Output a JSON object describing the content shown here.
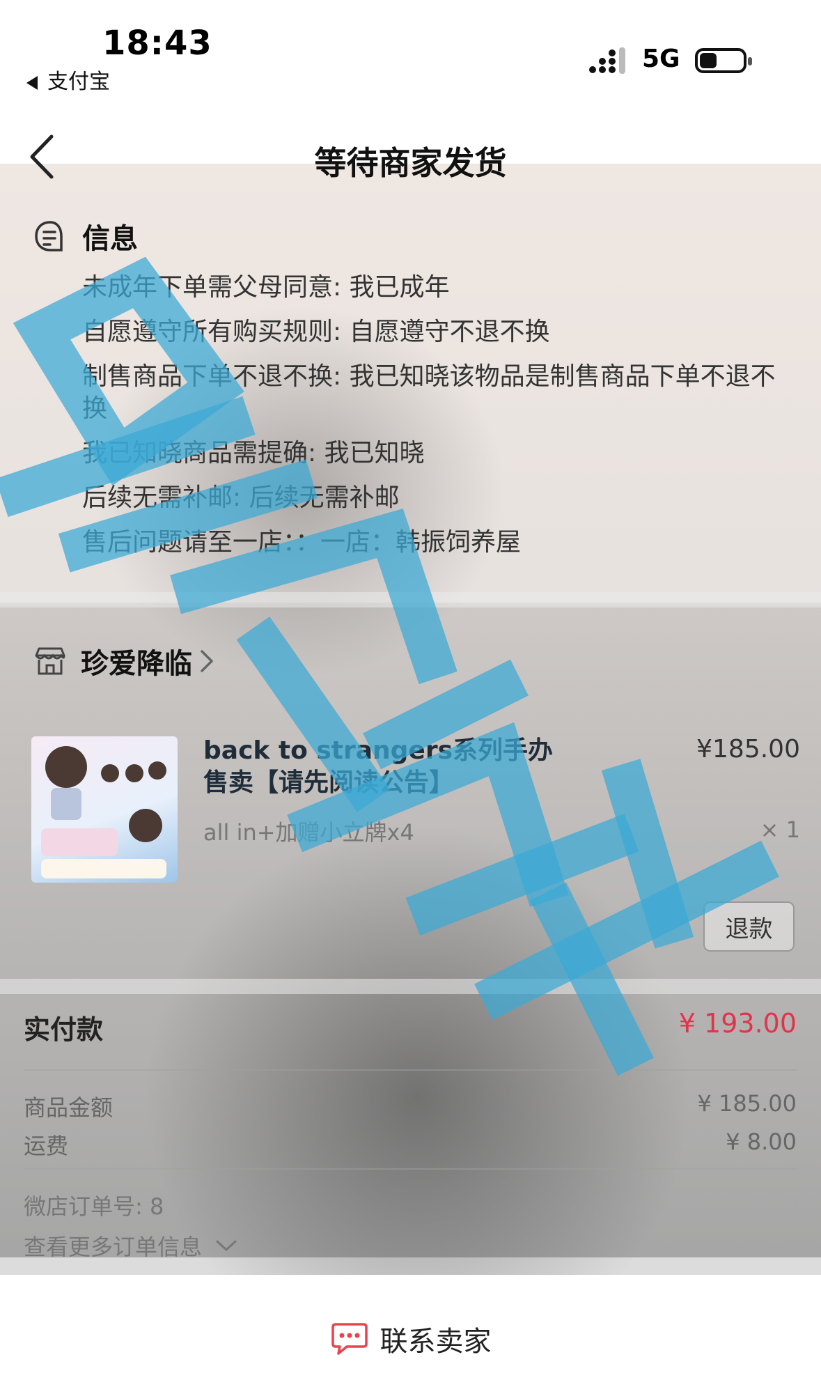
{
  "status_bar": {
    "time": "18:43",
    "back_app": "支付宝",
    "network": "5G"
  },
  "header": {
    "title": "等待商家发货"
  },
  "info": {
    "heading": "信息",
    "lines": [
      "未成年下单需父母同意: 我已成年",
      "自愿遵守所有购买规则: 自愿遵守不退不换",
      "制售商品下单不退不换: 我已知晓该物品是制售商品下单不退不换",
      "我已知晓商品需提确: 我已知晓",
      "后续无需补邮: 后续无需补邮",
      "售后问题请至一店：：一店：韩振饲养屋"
    ]
  },
  "shop": {
    "name": "珍爱降临"
  },
  "product": {
    "title": "back to strangers系列手办售卖【请先阅读公告】",
    "price": "¥185.00",
    "spec": "all in+加赠小立牌x4",
    "quantity": "× 1",
    "refund_label": "退款"
  },
  "payment": {
    "total_label": "实付款",
    "total_amount": "¥ 193.00",
    "goods_label": "商品金额",
    "goods_amount": "¥ 185.00",
    "shipping_label": "运费",
    "shipping_amount": "¥ 8.00",
    "order_no_label": "微店订单号: 8",
    "more_label": "查看更多订单信息"
  },
  "bottom": {
    "contact_label": "联系卖家"
  },
  "colors": {
    "price_red": "#e2334a",
    "watermark_blue": "#3aa9d6",
    "contact_red": "#e8434f"
  },
  "icons": {
    "back": "chevron-left-icon",
    "info": "message-doc-icon",
    "shop": "store-icon",
    "contact": "chat-bubble-icon"
  }
}
